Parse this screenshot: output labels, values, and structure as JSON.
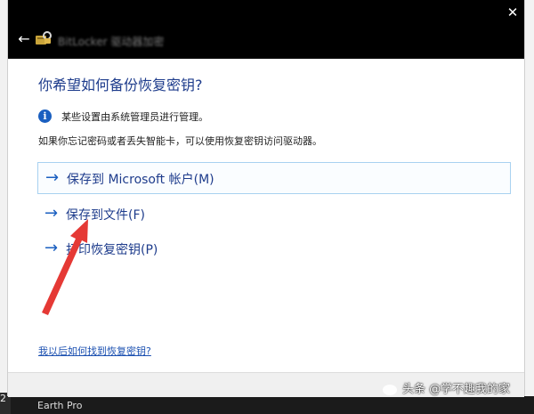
{
  "window": {
    "title": "BitLocker 驱动器加密",
    "back_icon": "back-arrow-icon",
    "close_icon": "close-icon"
  },
  "main": {
    "heading": "你希望如何备份恢复密钥?",
    "info_text": "某些设置由系统管理员进行管理。",
    "description": "如果你忘记密码或者丢失智能卡，可以使用恢复密钥访问驱动器。",
    "options": [
      {
        "label": "保存到 Microsoft 帐户(M)",
        "icon": "arrow-right-icon"
      },
      {
        "label": "保存到文件(F)",
        "icon": "arrow-right-icon"
      },
      {
        "label": "打印恢复密钥(P)",
        "icon": "arrow-right-icon"
      }
    ],
    "help_link": "我以后如何找到恢复密钥?"
  },
  "background": {
    "taskbar_text": "Earth Pro",
    "left_fragment": "2"
  },
  "watermark": "头条 @学不趣我的家",
  "colors": {
    "accent": "#1a5fc0",
    "heading": "#1e3c8c",
    "annotation_arrow": "#e53935"
  }
}
